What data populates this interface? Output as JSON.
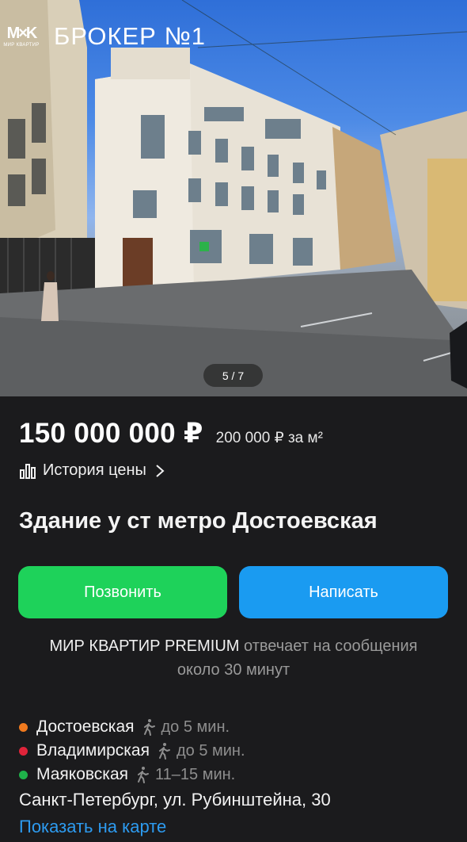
{
  "gallery": {
    "brand_name": "БРОКЕР №1",
    "logo_mark": "M×K",
    "logo_sub": "МИР КВАРТИР",
    "counter": "5 / 7"
  },
  "listing": {
    "price": "150 000 000 ₽",
    "price_per_m2": "200 000 ₽ за м²",
    "price_history_label": "История цены",
    "title": "Здание у ст метро Достоевская"
  },
  "actions": {
    "call_label": "Позвонить",
    "write_label": "Написать"
  },
  "agency": {
    "name": "МИР КВАРТИР PREMIUM",
    "response_text": "отвечает на сообщения",
    "response_time": "около 30 минут"
  },
  "metro": [
    {
      "station": "Достоевская",
      "time": "до 5 мин.",
      "color": "#f07a1e",
      "mode_icon": "walk-icon"
    },
    {
      "station": "Владимирская",
      "time": "до 5 мин.",
      "color": "#e0243a",
      "mode_icon": "walk-icon"
    },
    {
      "station": "Маяковская",
      "time": "11–15 мин.",
      "color": "#1fb24a",
      "mode_icon": "walk-icon"
    }
  ],
  "location": {
    "address": "Санкт-Петербург, ул. Рубинштейна, 30",
    "map_link": "Показать на карте"
  },
  "colors": {
    "background": "#1b1b1d",
    "call_button": "#1ed25a",
    "write_button": "#1a9bf1",
    "link": "#2d9bf0"
  }
}
